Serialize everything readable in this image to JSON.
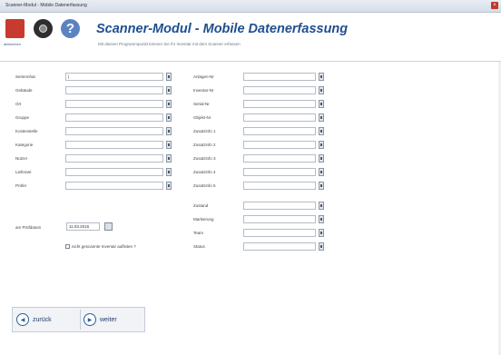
{
  "window": {
    "title": "Scanner-Modul - Mobile Datenerfassung"
  },
  "toolbar": {
    "exit_label": "abbrechen"
  },
  "header": {
    "title": "Scanner-Modul - Mobile Datenerfassung",
    "subtitle": "Mit diesem Programmpunkt können Sie Ihr Inventar mit dem Scanner erfassen"
  },
  "left_fields": [
    {
      "label": "Seriennhat",
      "value": "|"
    },
    {
      "label": "Gebäude",
      "value": ""
    },
    {
      "label": "Ort",
      "value": ""
    },
    {
      "label": "Gruppe",
      "value": ""
    },
    {
      "label": "Kostenstelle",
      "value": ""
    },
    {
      "label": "Kategorie",
      "value": ""
    },
    {
      "label": "Nutzer",
      "value": ""
    },
    {
      "label": "Lieferant",
      "value": ""
    },
    {
      "label": "Prüfer",
      "value": ""
    }
  ],
  "right_fields": [
    {
      "label": "Anlagen-Nr",
      "value": ""
    },
    {
      "label": "Inventar-Nr",
      "value": ""
    },
    {
      "label": "Serial-Nr",
      "value": ""
    },
    {
      "label": "Objekt-Nr",
      "value": ""
    },
    {
      "label": "Zusatzinfo 1",
      "value": ""
    },
    {
      "label": "Zusatzinfo 2",
      "value": ""
    },
    {
      "label": "Zusatzinfo 3",
      "value": ""
    },
    {
      "label": "Zusatzinfo 4",
      "value": ""
    },
    {
      "label": "Zusatzinfo 5",
      "value": ""
    }
  ],
  "right_fields_2": [
    {
      "label": "Zustand",
      "value": ""
    },
    {
      "label": "Markierung",
      "value": ""
    },
    {
      "label": "Team",
      "value": ""
    },
    {
      "label": "Status",
      "value": ""
    }
  ],
  "date": {
    "label": "am Prüfdatum",
    "value": "11.03.2016"
  },
  "checkbox": {
    "label": "nicht gescannte Inventar auflisten ?"
  },
  "nav": {
    "back": "zurück",
    "next": "weiter"
  },
  "colors": {
    "title": "#1f4f8f",
    "accent": "#2e5f9a",
    "exit": "#c93a2e"
  }
}
